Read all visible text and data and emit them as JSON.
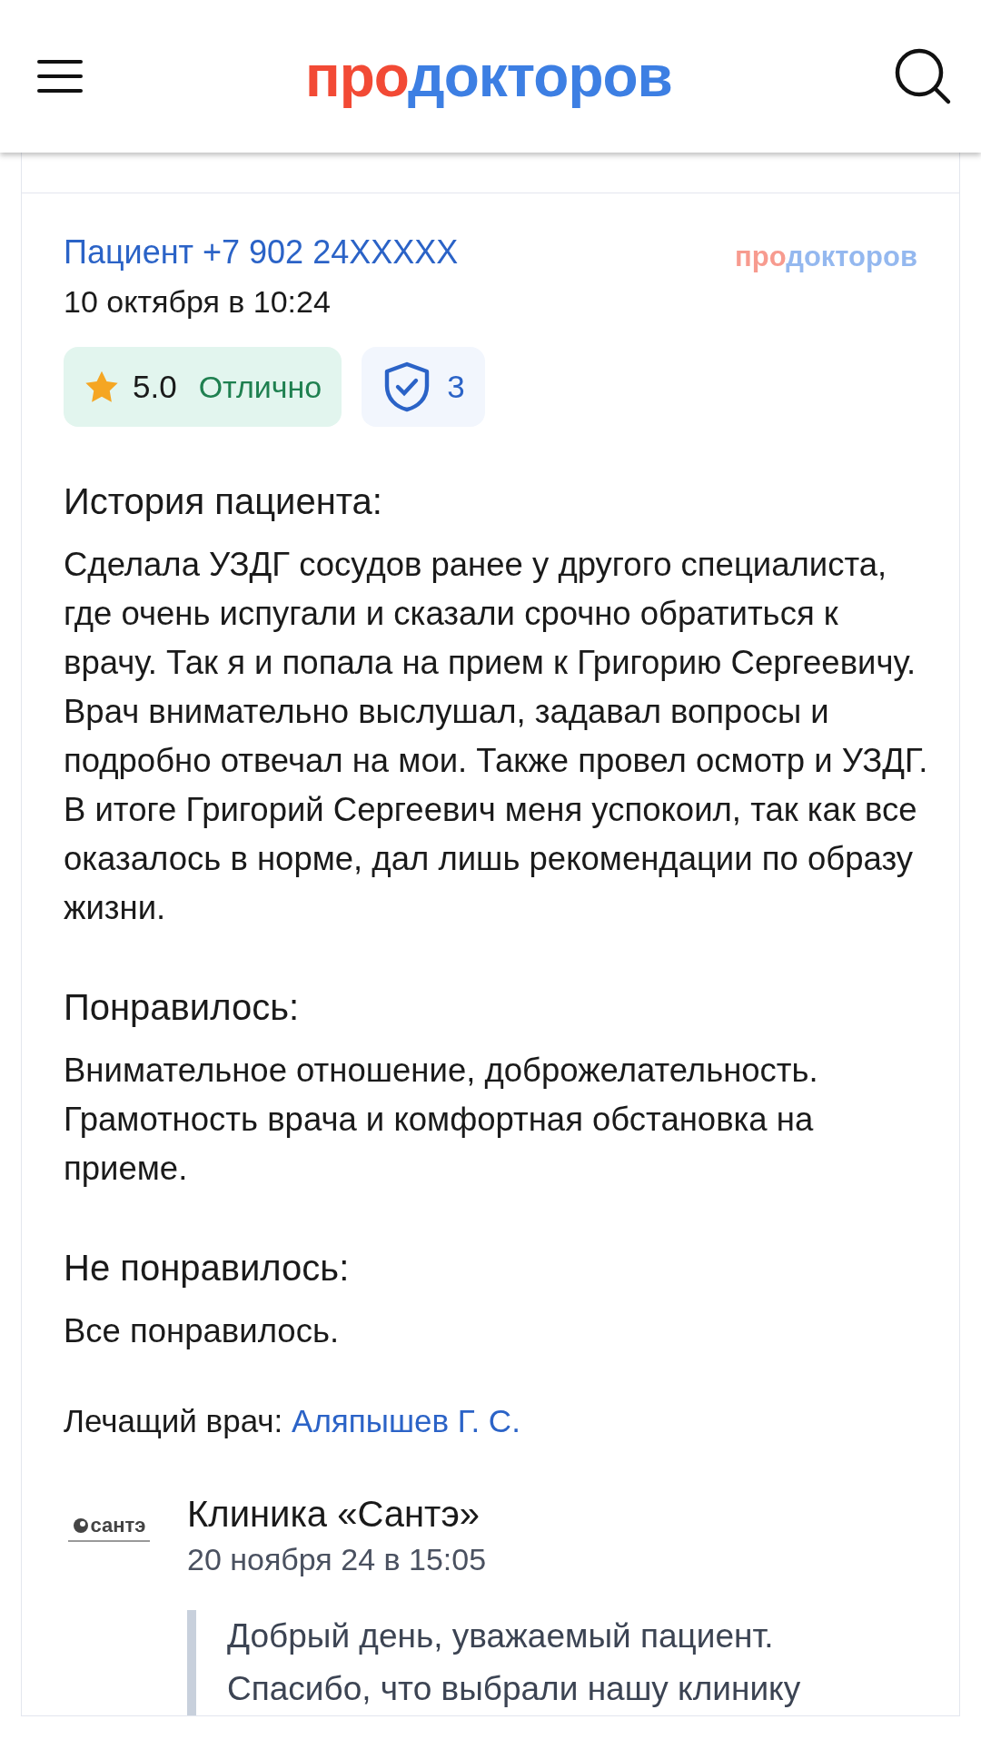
{
  "header": {
    "logo": {
      "prefix": "про",
      "rest": "докторов"
    }
  },
  "review": {
    "author": "Пациент +7 902 24XXXXX",
    "date": "10 октября в 10:24",
    "source_logo": {
      "prefix": "про",
      "rest": "докторов"
    },
    "rating": {
      "score": "5.0",
      "verdict": "Отлично"
    },
    "verified": {
      "count": "3"
    },
    "sections": [
      {
        "title": "История пациента:",
        "text": "Сделала УЗДГ сосудов ранее у другого специалиста, где очень испугали и сказали срочно обратиться к врачу. Так я и попала на прием к Григорию Сергеевичу. Врач внимательно выслушал, задавал вопросы и подробно отвечал на мои. Также провел осмотр и УЗДГ. В итоге Григорий Сергеевич меня успокоил, так как все оказалось в норме, дал лишь рекомендации по образу жизни."
      },
      {
        "title": "Понравилось:",
        "text": "Внимательное отношение, доброжелательность. Грамотность врача и комфортная обстановка на приеме."
      },
      {
        "title": "Не понравилось:",
        "text": "Все понравилось."
      }
    ],
    "doctor": {
      "label": "Лечащий врач:",
      "name": "Аляпышев Г. С."
    },
    "reply": {
      "logo": {
        "name": "сантэ"
      },
      "clinic": "Клиника «Сантэ»",
      "date": "20 ноября 24 в 15:05",
      "text": "Добрый день, уважаемый пациент. Спасибо, что выбрали нашу клинику"
    }
  }
}
